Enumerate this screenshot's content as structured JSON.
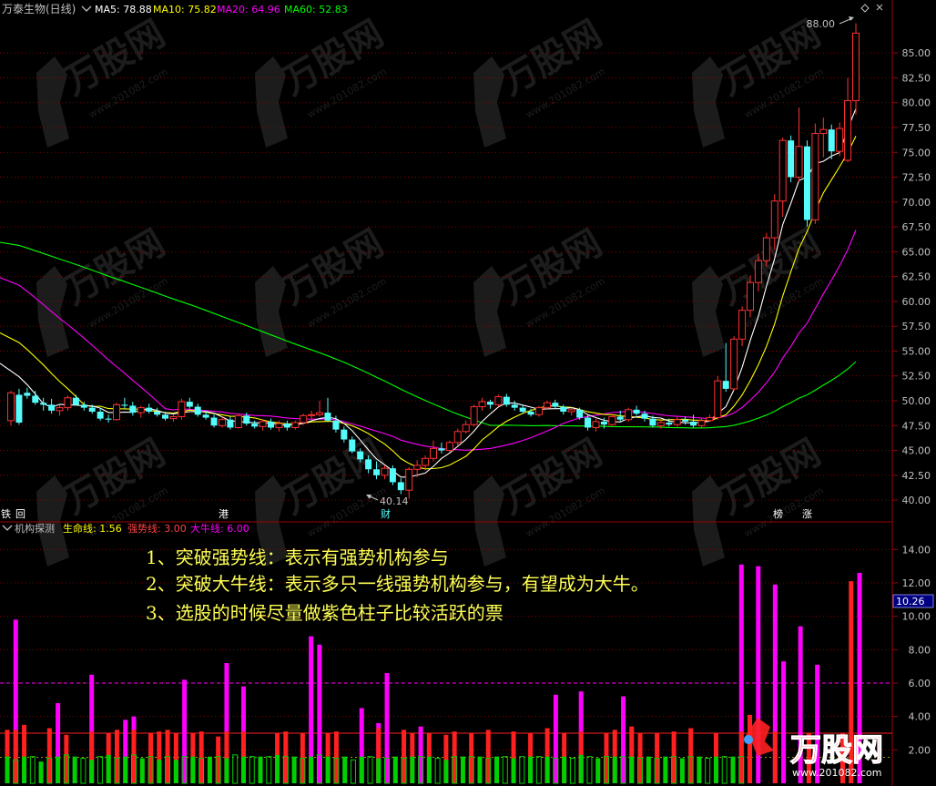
{
  "colors": {
    "background": "#000000",
    "up": "#ff3232",
    "down": "#54fcfc",
    "ma5": "#ffffff",
    "ma10": "#ffff00",
    "ma20": "#ff00ff",
    "ma60": "#00ff00",
    "grid": "#a00000",
    "axis_text": "#c0c0c0",
    "annotation": "#ffff55",
    "magenta_bar": "#ff00ff",
    "red_bar": "#ff2020",
    "green_bar": "#00d000"
  },
  "header": {
    "stock_name": "万泰生物(日线)",
    "ma5_label": "MA5: 78.88",
    "ma10_label": "MA10: 75.82",
    "ma20_label": "MA20: 64.96",
    "ma60_label": "MA60: 52.83"
  },
  "main_chart": {
    "y_ticks": [
      "85.00",
      "82.50",
      "80.00",
      "77.50",
      "75.00",
      "72.50",
      "70.00",
      "67.50",
      "65.00",
      "62.50",
      "60.00",
      "57.50",
      "55.00",
      "52.50",
      "50.00",
      "47.50",
      "45.00",
      "42.50",
      "40.00"
    ],
    "high_label": "88.00",
    "low_label": "40.14",
    "event_markers": [
      "铁",
      "回",
      "港",
      "财",
      "榜",
      "涨"
    ]
  },
  "indicator": {
    "name": "机构探测",
    "life_label": "生命线: 1.56",
    "strong_label": "强势线: 3.00",
    "bull_label": "大牛线: 6.00",
    "current_value": "10.26",
    "y_ticks": [
      "14.00",
      "12.00",
      "10.00",
      "8.00",
      "6.00",
      "4.00",
      "2.00"
    ]
  },
  "annotations": [
    "1、突破强势线：表示有强势机构参与",
    "2、突破大牛线：表示多只一线强势机构参与，有望成为大牛。",
    "3、选股的时候尽量做紫色柱子比较活跃的票"
  ],
  "watermark": {
    "brand": "万股网",
    "url": "www.201082.com"
  },
  "chart_data": [
    {
      "type": "candlestick",
      "title": "万泰生物(日线)",
      "ylim": [
        39.0,
        88.5
      ],
      "y_ticks": [
        40,
        42.5,
        45,
        47.5,
        50,
        52.5,
        55,
        57.5,
        60,
        62.5,
        65,
        67.5,
        70,
        72.5,
        75,
        77.5,
        80,
        82.5,
        85
      ],
      "ohlc": [
        [
          48.0,
          51.0,
          47.5,
          50.8
        ],
        [
          50.6,
          51.2,
          47.6,
          47.8
        ],
        [
          50.8,
          51.3,
          50.2,
          50.5
        ],
        [
          50.5,
          51.0,
          49.6,
          49.8
        ],
        [
          49.8,
          50.3,
          49.0,
          49.6
        ],
        [
          49.6,
          50.2,
          48.7,
          49.0
        ],
        [
          49.0,
          49.6,
          48.5,
          49.3
        ],
        [
          49.3,
          50.5,
          49.0,
          50.3
        ],
        [
          50.3,
          50.6,
          49.5,
          49.6
        ],
        [
          49.6,
          49.9,
          49.0,
          49.3
        ],
        [
          49.3,
          49.6,
          48.7,
          48.9
        ],
        [
          48.9,
          49.3,
          48.0,
          48.2
        ],
        [
          48.2,
          48.6,
          47.8,
          48.1
        ],
        [
          48.1,
          49.8,
          48.0,
          49.6
        ],
        [
          49.6,
          50.3,
          49.2,
          49.5
        ],
        [
          49.5,
          49.9,
          48.5,
          48.8
        ],
        [
          48.8,
          49.5,
          48.3,
          49.3
        ],
        [
          49.3,
          49.7,
          48.7,
          48.9
        ],
        [
          48.9,
          49.3,
          48.4,
          48.6
        ],
        [
          48.6,
          48.9,
          48.0,
          48.2
        ],
        [
          48.2,
          48.6,
          47.9,
          48.4
        ],
        [
          48.4,
          50.2,
          48.1,
          49.9
        ],
        [
          49.9,
          50.3,
          49.2,
          49.4
        ],
        [
          49.4,
          49.7,
          48.4,
          48.6
        ],
        [
          48.6,
          49.0,
          48.1,
          48.3
        ],
        [
          48.3,
          48.6,
          47.3,
          47.5
        ],
        [
          47.5,
          48.4,
          47.3,
          48.1
        ],
        [
          48.1,
          48.4,
          47.1,
          47.3
        ],
        [
          47.3,
          48.7,
          47.2,
          48.5
        ],
        [
          48.5,
          48.8,
          47.5,
          47.7
        ],
        [
          47.7,
          48.0,
          47.2,
          47.4
        ],
        [
          47.4,
          48.1,
          47.0,
          47.9
        ],
        [
          47.9,
          48.2,
          47.1,
          47.3
        ],
        [
          47.3,
          48.0,
          46.9,
          47.7
        ],
        [
          47.7,
          48.0,
          47.0,
          47.3
        ],
        [
          47.3,
          48.0,
          47.1,
          47.8
        ],
        [
          47.8,
          48.7,
          47.6,
          48.5
        ],
        [
          48.5,
          49.0,
          48.1,
          48.6
        ],
        [
          48.6,
          50.0,
          48.4,
          48.8
        ],
        [
          48.8,
          50.3,
          47.9,
          48.0
        ],
        [
          48.0,
          48.5,
          46.8,
          47.1
        ],
        [
          47.1,
          47.4,
          45.8,
          46.1
        ],
        [
          46.1,
          46.4,
          44.7,
          44.9
        ],
        [
          44.9,
          45.2,
          43.8,
          44.1
        ],
        [
          44.1,
          44.5,
          42.7,
          43.1
        ],
        [
          43.1,
          43.9,
          42.1,
          42.5
        ],
        [
          42.5,
          43.5,
          42.1,
          43.2
        ],
        [
          43.2,
          43.5,
          41.5,
          41.8
        ],
        [
          41.8,
          42.2,
          40.6,
          41.0
        ],
        [
          41.0,
          43.3,
          40.14,
          43.1
        ],
        [
          43.1,
          44.0,
          42.3,
          43.5
        ],
        [
          43.5,
          44.5,
          43.0,
          44.2
        ],
        [
          44.2,
          46.0,
          43.9,
          45.2
        ],
        [
          45.2,
          45.8,
          44.7,
          45.0
        ],
        [
          45.0,
          46.0,
          44.8,
          45.8
        ],
        [
          45.8,
          47.2,
          45.5,
          46.9
        ],
        [
          46.9,
          48.0,
          46.7,
          47.6
        ],
        [
          47.6,
          49.6,
          47.4,
          49.4
        ],
        [
          49.4,
          50.3,
          49.0,
          49.9
        ],
        [
          49.9,
          50.1,
          49.2,
          49.6
        ],
        [
          49.6,
          50.6,
          49.4,
          50.4
        ],
        [
          50.4,
          50.7,
          49.4,
          49.6
        ],
        [
          49.6,
          50.0,
          49.0,
          49.3
        ],
        [
          49.3,
          49.6,
          48.7,
          48.9
        ],
        [
          48.9,
          49.2,
          48.4,
          48.6
        ],
        [
          48.6,
          49.5,
          48.4,
          49.3
        ],
        [
          49.3,
          50.0,
          49.1,
          49.8
        ],
        [
          49.8,
          50.1,
          49.2,
          49.4
        ],
        [
          49.4,
          49.6,
          48.6,
          48.9
        ],
        [
          48.9,
          49.3,
          48.5,
          49.1
        ],
        [
          49.1,
          49.3,
          48.1,
          48.3
        ],
        [
          48.3,
          48.6,
          47.0,
          47.3
        ],
        [
          47.3,
          48.2,
          46.9,
          47.9
        ],
        [
          47.9,
          48.3,
          47.2,
          47.6
        ],
        [
          47.6,
          48.6,
          47.5,
          48.4
        ],
        [
          48.4,
          49.0,
          47.9,
          48.1
        ],
        [
          48.1,
          49.3,
          47.9,
          49.1
        ],
        [
          49.1,
          49.5,
          48.5,
          48.7
        ],
        [
          48.7,
          49.0,
          47.9,
          48.2
        ],
        [
          48.2,
          48.5,
          47.3,
          47.5
        ],
        [
          47.5,
          48.0,
          47.2,
          47.8
        ],
        [
          47.8,
          48.2,
          47.4,
          47.6
        ],
        [
          47.6,
          48.4,
          47.4,
          48.1
        ],
        [
          48.1,
          48.4,
          47.6,
          47.9
        ],
        [
          47.9,
          48.6,
          47.3,
          47.5
        ],
        [
          47.5,
          48.2,
          47.2,
          48.0
        ],
        [
          48.0,
          48.6,
          47.9,
          48.3
        ],
        [
          48.3,
          52.5,
          48.1,
          52.0
        ],
        [
          52.0,
          55.8,
          50.9,
          51.2
        ],
        [
          51.2,
          56.5,
          51.0,
          56.2
        ],
        [
          56.2,
          59.5,
          55.5,
          59.1
        ],
        [
          59.1,
          62.6,
          58.4,
          61.9
        ],
        [
          61.9,
          64.8,
          61.0,
          64.1
        ],
        [
          64.1,
          66.9,
          63.5,
          66.4
        ],
        [
          66.4,
          70.8,
          65.2,
          70.1
        ],
        [
          70.1,
          76.5,
          68.5,
          76.2
        ],
        [
          76.2,
          76.7,
          72.0,
          72.5
        ],
        [
          72.5,
          79.5,
          72.0,
          75.6
        ],
        [
          75.6,
          76.2,
          67.5,
          68.2
        ],
        [
          68.2,
          77.9,
          67.8,
          76.9
        ],
        [
          76.9,
          78.5,
          74.5,
          77.3
        ],
        [
          77.3,
          77.8,
          74.3,
          75.1
        ],
        [
          75.1,
          78.0,
          74.6,
          77.4
        ],
        [
          74.2,
          82.5,
          74.0,
          80.2
        ],
        [
          80.2,
          88.0,
          78.8,
          87.0
        ]
      ],
      "ma5_endpoint": 78.88,
      "ma10_endpoint": 75.82,
      "ma20_endpoint": 64.96,
      "ma60_endpoint": 52.83,
      "ma60_start": 66.2,
      "ma20_start": 63.0,
      "ma10_start": 57.5,
      "ma5_start": 54.5
    },
    {
      "type": "bar",
      "title": "机构探测",
      "ylim": [
        0,
        15
      ],
      "y_ticks": [
        2,
        4,
        6,
        8,
        10,
        12,
        14
      ],
      "reference_lines": [
        {
          "name": "生命线",
          "value": 1.56
        },
        {
          "name": "强势线",
          "value": 3.0
        },
        {
          "name": "大牛线",
          "value": 6.0
        }
      ],
      "magenta_values": [
        0,
        9.8,
        0,
        0,
        0,
        0,
        4.8,
        0,
        0,
        0,
        6.5,
        0,
        0,
        0,
        3.8,
        4.0,
        0,
        0,
        0,
        0,
        0,
        6.2,
        0,
        0,
        0,
        0,
        7.2,
        0,
        5.8,
        0,
        0,
        0,
        0,
        0,
        0,
        0,
        8.8,
        8.3,
        0,
        0,
        0,
        0,
        4.5,
        0,
        3.6,
        6.6,
        0,
        0,
        0,
        3.4,
        0,
        0,
        0,
        0,
        0,
        0,
        0,
        0,
        0,
        0,
        0,
        0,
        0,
        0,
        0,
        5.3,
        0,
        0,
        5.5,
        0,
        0,
        0,
        0,
        5.2,
        0,
        0,
        0,
        0,
        0,
        0,
        0,
        0,
        0,
        0,
        0,
        0,
        0,
        13.1,
        0,
        13.0,
        0,
        11.9,
        7.3,
        0,
        9.4,
        0,
        7.1,
        0,
        0,
        0,
        0,
        12.6
      ],
      "red_values": [
        3.2,
        3.2,
        3.5,
        0,
        0,
        3.3,
        0,
        2.9,
        0,
        0,
        3.1,
        0,
        3.0,
        3.2,
        0,
        3.2,
        0,
        3.0,
        3.1,
        3.2,
        3.0,
        0,
        3.0,
        3.1,
        0,
        2.8,
        3.1,
        0,
        3.1,
        0,
        0,
        0,
        3.0,
        3.1,
        0,
        3.0,
        0,
        0,
        3.0,
        3.1,
        0,
        0,
        0,
        0,
        3.3,
        0,
        0,
        3.2,
        3.0,
        0,
        3.0,
        0,
        2.9,
        3.1,
        0,
        3.0,
        0,
        3.2,
        0,
        0,
        3.1,
        0,
        3.0,
        0,
        3.3,
        0,
        3.0,
        0,
        3.1,
        0,
        0,
        3.0,
        3.2,
        0,
        3.4,
        3.0,
        0,
        3.0,
        0,
        3.1,
        0,
        3.3,
        0,
        0,
        3.0,
        0,
        0,
        3.1,
        4.1,
        0,
        0,
        3.1,
        0,
        0,
        0,
        3.0,
        0,
        0,
        0,
        3.0,
        12.1,
        0,
        0,
        0,
        0
      ],
      "green_values": [
        1.6,
        1.4,
        1.6,
        1.6,
        1.3,
        1.5,
        1.6,
        1.7,
        1.6,
        1.5,
        1.4,
        1.6,
        1.7,
        1.5,
        1.6,
        1.7,
        1.5,
        1.6,
        1.4,
        1.6,
        1.4,
        1.6,
        1.6,
        1.5,
        1.6,
        1.6,
        1.5,
        1.7,
        1.6,
        1.6,
        1.6,
        1.6,
        1.7,
        1.6,
        1.6,
        1.5,
        1.6,
        1.7,
        1.6,
        1.5,
        1.6,
        1.4,
        1.6,
        1.6,
        1.5,
        1.5,
        1.6,
        1.5,
        1.6,
        1.6,
        1.6,
        1.5,
        1.4,
        1.6,
        1.6,
        1.6,
        1.6,
        1.5,
        1.6,
        1.6,
        1.5,
        1.6,
        1.6,
        1.6,
        1.6,
        1.5,
        1.6,
        1.5,
        1.7,
        1.6,
        1.5,
        1.6,
        1.6,
        1.6,
        1.6,
        1.5,
        1.6,
        1.5,
        1.6,
        1.6,
        1.5,
        1.6,
        1.6,
        1.5,
        1.6,
        1.6,
        1.6,
        1.6,
        0,
        0,
        0,
        0,
        0,
        0,
        0,
        0,
        0,
        0,
        0,
        0,
        0,
        0,
        0,
        0,
        0
      ]
    }
  ]
}
